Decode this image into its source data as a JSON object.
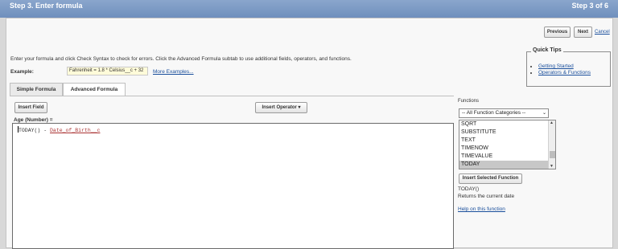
{
  "header": {
    "title": "Step 3. Enter formula",
    "step": "Step 3 of 6"
  },
  "nav": {
    "previous": "Previous",
    "next": "Next",
    "cancel": "Cancel"
  },
  "instructions": "Enter your formula and click Check Syntax to check for errors. Click the Advanced Formula subtab to use additional fields, operators, and functions.",
  "example": {
    "label": "Example:",
    "value": "Fahrenheit = 1.8 * Celsius__c + 32",
    "more": "More Examples..."
  },
  "tabs": [
    {
      "label": "Simple Formula",
      "active": false
    },
    {
      "label": "Advanced Formula",
      "active": true
    }
  ],
  "quick_tips": {
    "title": "Quick Tips",
    "links": [
      "Getting Started",
      "Operators & Functions"
    ]
  },
  "toolbar": {
    "insert_field": "Insert Field",
    "insert_operator": "Insert Operator"
  },
  "formula": {
    "label": "Age (Number) =",
    "function_text": "TODAY() - ",
    "field_text": "Date_of_Birth__c"
  },
  "functions": {
    "label": "Functions",
    "category": "-- All Function Categories --",
    "items": [
      "SQRT",
      "SUBSTITUTE",
      "TEXT",
      "TIMENOW",
      "TIMEVALUE",
      "TODAY"
    ],
    "selected": "TODAY",
    "insert_button": "Insert Selected Function",
    "signature": "TODAY()",
    "description": "Returns the current date",
    "help_link": "Help on this function"
  }
}
